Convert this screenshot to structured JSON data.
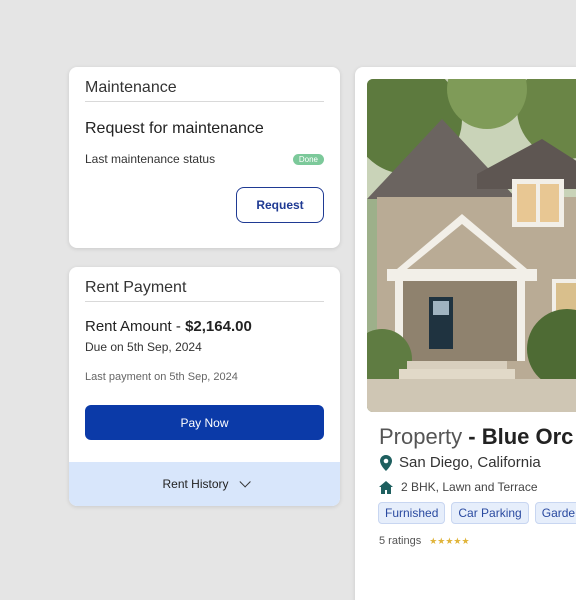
{
  "maintenance": {
    "title": "Maintenance",
    "heading": "Request for maintenance",
    "status_label": "Last maintenance status",
    "status_badge": "Done",
    "request_button": "Request"
  },
  "rent": {
    "title": "Rent Payment",
    "amount_label": "Rent Amount - ",
    "amount_value": "$2,164.00",
    "due": "Due on 5th Sep, 2024",
    "last_payment": "Last payment on 5th Sep, 2024",
    "pay_button": "Pay Now",
    "history_label": "Rent History"
  },
  "property": {
    "title_prefix": "Property",
    "title_name": " - Blue Orc",
    "location": "San Diego, California",
    "details": "2 BHK, Lawn and Terrace",
    "tags": [
      "Furnished",
      "Car Parking",
      "Garde"
    ],
    "ratings_text": "5 ratings",
    "stars": "★★★★★",
    "rating_value": 5,
    "rating_max": 5
  },
  "colors": {
    "primary": "#0b3aa8",
    "history_bg": "#d8e6fb",
    "done_badge": "#7cc99a",
    "star": "#e0b43a"
  },
  "icons": {
    "location": "location-pin-icon",
    "home": "home-icon",
    "chevron": "chevron-down-icon"
  }
}
